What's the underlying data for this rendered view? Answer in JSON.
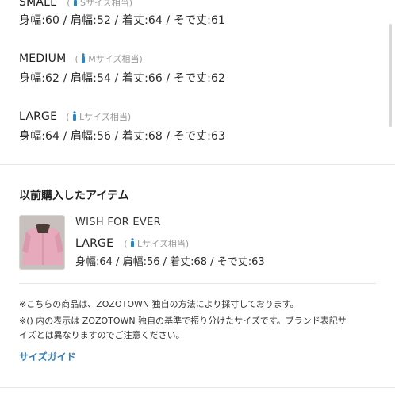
{
  "sizes": [
    {
      "name": "SMALL",
      "hint": "Sサイズ相当",
      "measurements": "身幅:60 / 肩幅:52 / 着丈:64 / そで丈:61"
    },
    {
      "name": "MEDIUM",
      "hint": "Mサイズ相当",
      "measurements": "身幅:62 / 肩幅:54 / 着丈:66 / そで丈:62"
    },
    {
      "name": "LARGE",
      "hint": "Lサイズ相当",
      "measurements": "身幅:64 / 肩幅:56 / 着丈:68 / そで丈:63"
    }
  ],
  "previous": {
    "title": "以前購入したアイテム",
    "item_name": "WISH FOR EVER",
    "size_name": "LARGE",
    "size_hint": "Lサイズ相当",
    "measurements": "身幅:64 / 肩幅:56 / 着丈:68 / そで丈:63"
  },
  "notes": {
    "line1": "※こちらの商品は、ZOZOTOWN 独自の方法により採寸しております。",
    "line2": "※() 内の表示は ZOZOTOWN 独自の基準で振り分けたサイズです。ブランド表記サ",
    "line3": "イズとは異なりますのでご注意ください。"
  },
  "size_guide_label": "サイズガイド",
  "colors": {
    "accent_link": "#2f7fc0",
    "person_icon": "#2e86c1",
    "hint_text": "#9a9a9a"
  }
}
